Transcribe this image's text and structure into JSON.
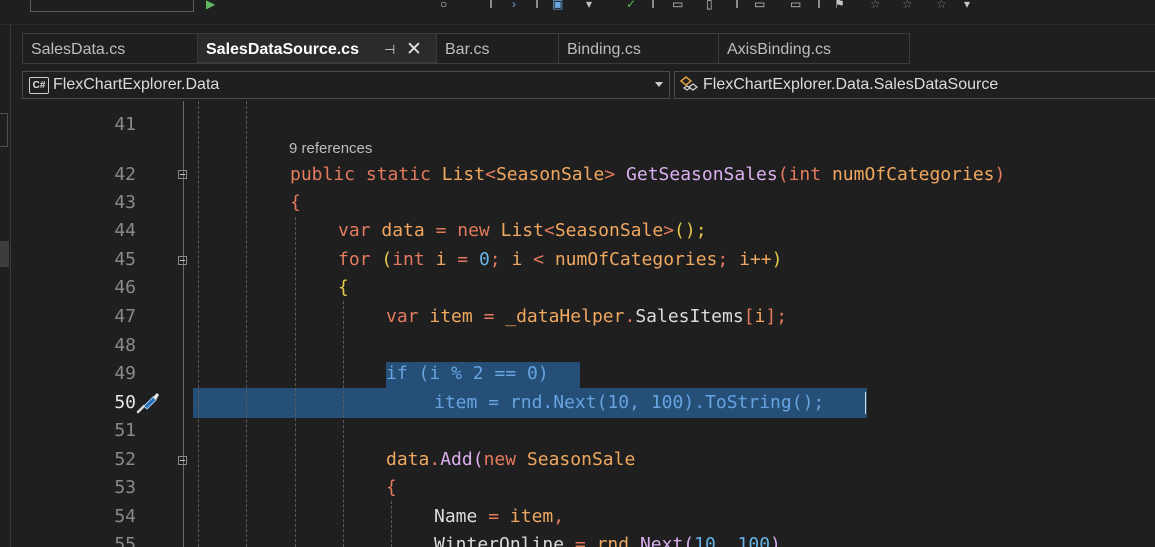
{
  "tabs": [
    {
      "label": "SalesData.cs",
      "active": false
    },
    {
      "label": "SalesDataSource.cs",
      "active": true,
      "pin_icon": "⊣",
      "close_icon": "✕"
    },
    {
      "label": "Bar.cs",
      "active": false
    },
    {
      "label": "Binding.cs",
      "active": false
    },
    {
      "label": "AxisBinding.cs",
      "active": false
    }
  ],
  "navbar": {
    "project_icon_label": "C#",
    "project": "FlexChartExplorer.Data",
    "member": "FlexChartExplorer.Data.SalesDataSource"
  },
  "editor": {
    "codelens": "9 references",
    "current_line": 50,
    "lines": [
      {
        "num": "41"
      },
      {
        "num": "42"
      },
      {
        "num": "43"
      },
      {
        "num": "44"
      },
      {
        "num": "45"
      },
      {
        "num": "46"
      },
      {
        "num": "47"
      },
      {
        "num": "48"
      },
      {
        "num": "49"
      },
      {
        "num": "50"
      },
      {
        "num": "51"
      },
      {
        "num": "52"
      },
      {
        "num": "53"
      },
      {
        "num": "54"
      },
      {
        "num": "55"
      }
    ],
    "code": {
      "l42": {
        "public": "public",
        "static": "static",
        "list": "List",
        "lt": "<",
        "type": "SeasonSale",
        "gt": ">",
        "method": "GetSeasonSales",
        "paren_open": "(",
        "int": "int",
        "param": "numOfCategories",
        "paren_close": ")"
      },
      "l43": {
        "brace": "{"
      },
      "l44": {
        "var": "var",
        "name": "data",
        "eq": "=",
        "new": "new",
        "list": "List",
        "lt": "<",
        "type": "SeasonSale",
        "gt": ">",
        "call": "();"
      },
      "l45": {
        "for": "for",
        "open": "(",
        "int": "int",
        "var_i": "i",
        "eq": "=",
        "zero": "0",
        "semi1": ";",
        "i2": "i",
        "lt": "<",
        "bound": "numOfCategories",
        "semi2": ";",
        "inc": "i++",
        "close": ")"
      },
      "l46": {
        "brace": "{"
      },
      "l47": {
        "var": "var",
        "name": "item",
        "eq": "=",
        "helper": "_dataHelper",
        "dot": ".",
        "prop": "SalesItems",
        "open": "[",
        "idx": "i",
        "close": "]",
        "semi": ";"
      },
      "l49": {
        "if": "if",
        "open": "(",
        "i": "i",
        "mod": "%",
        "two": "2",
        "eqeq": "==",
        "zero": "0",
        "close": ")"
      },
      "l50": {
        "item": "item",
        "eq": "=",
        "rnd": "rnd",
        "dot": ".",
        "next": "Next",
        "open": "(",
        "a": "10",
        "comma": ",",
        "b": "100",
        "close": ")",
        "dot2": ".",
        "tostring": "ToString",
        "call": "()",
        "semi": ";"
      },
      "l52": {
        "data": "data",
        "dot": ".",
        "add": "Add",
        "open": "(",
        "new": "new",
        "type": "SeasonSale"
      },
      "l53": {
        "brace": "{"
      },
      "l54": {
        "prop": "Name",
        "eq": "=",
        "val": "item",
        "comma": ","
      },
      "l55": {
        "prop": "WinterOnline",
        "eq": "=",
        "rnd": "rnd",
        "dot": ".",
        "next": "Next",
        "open": "(",
        "a": "10",
        "comma": ",",
        "b": "100",
        "close": ")"
      }
    }
  },
  "icons": {
    "screwdriver": "screwdriver-brush-icon",
    "class": "class-icon",
    "dropdown": "chevron-down-icon"
  },
  "colors": {
    "background": "#1f1f1f",
    "selection": "#264f78",
    "keyword": "#e37a5e",
    "type": "#f0a860",
    "method": "#dcb0f0",
    "number": "#66b3e6"
  }
}
